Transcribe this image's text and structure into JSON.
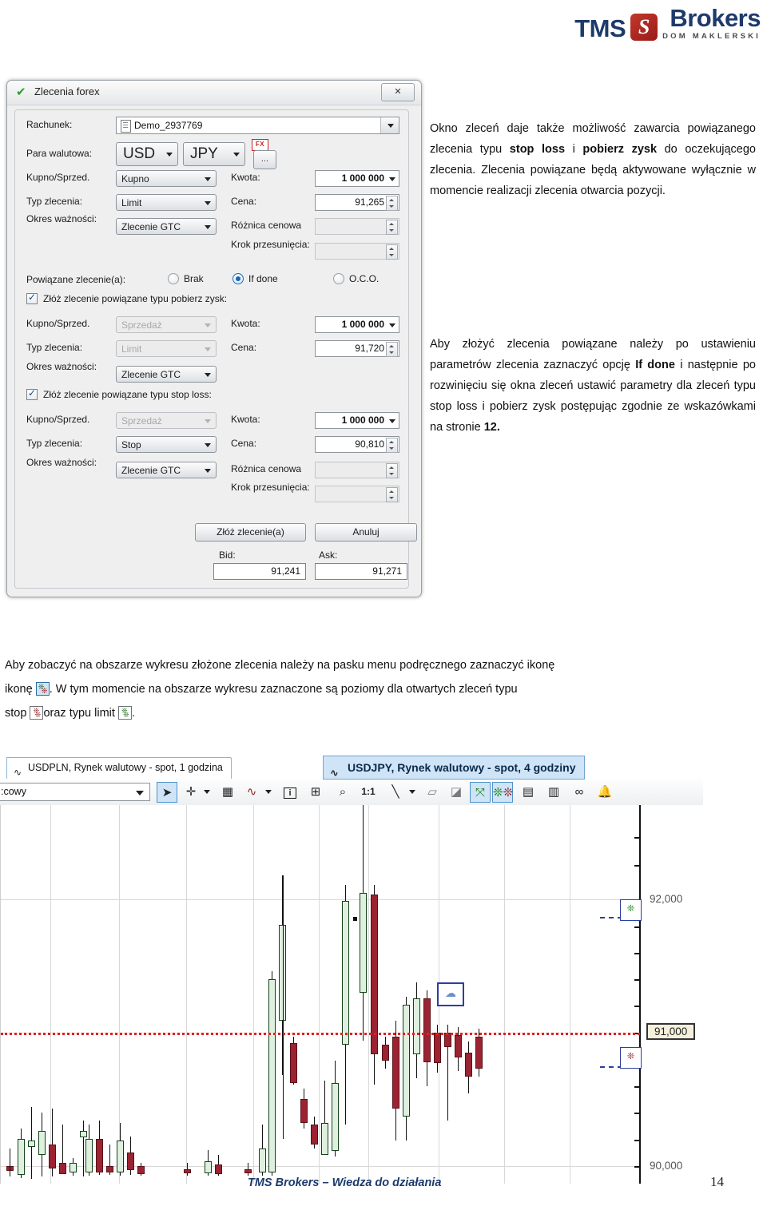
{
  "header": {
    "brand_left": "TMS",
    "brand_mark": "S",
    "brand_right": "Brokers",
    "brand_sub": "DOM MAKLERSKI",
    "brand_color": "#1d3a6b",
    "mark_color": "#9b1b1b"
  },
  "dialog": {
    "title": "Zlecenia forex",
    "close_label": "✕",
    "check_icon": "✔",
    "account": {
      "label": "Rachunek:",
      "value": "Demo_2937769"
    },
    "pair": {
      "label": "Para walutowa:",
      "base": "USD",
      "quote": "JPY",
      "fx_badge": "FX",
      "more_button": "..."
    },
    "main_order": {
      "side_label": "Kupno/Sprzed.",
      "side_value": "Kupno",
      "amount_label": "Kwota:",
      "amount_value": "1 000 000",
      "type_label": "Typ zlecenia:",
      "type_value": "Limit",
      "price_label": "Cena:",
      "price_value": "91,265",
      "validity_label": "Okres ważności:",
      "validity_value": "Zlecenie GTC",
      "spread_label": "Różnica cenowa",
      "spread_value": "",
      "step_label": "Krok przesunięcia:",
      "step_value": ""
    },
    "linked": {
      "label": "Powiązane zlecenie(a):",
      "option_none": "Brak",
      "option_ifdone": "If done",
      "option_oco": "O.C.O.",
      "selected": "If done"
    },
    "take_profit": {
      "checkbox_label": "Złóż zlecenie powiązane typu pobierz zysk:",
      "checked": true,
      "side_label": "Kupno/Sprzed.",
      "side_value": "Sprzedaż",
      "amount_label": "Kwota:",
      "amount_value": "1 000 000",
      "type_label": "Typ zlecenia:",
      "type_value": "Limit",
      "price_label": "Cena:",
      "price_value": "91,720",
      "validity_label": "Okres ważności:",
      "validity_value": "Zlecenie GTC"
    },
    "stop_loss": {
      "checkbox_label": "Złóż zlecenie powiązane typu stop loss:",
      "checked": true,
      "side_label": "Kupno/Sprzed.",
      "side_value": "Sprzedaż",
      "amount_label": "Kwota:",
      "amount_value": "1 000 000",
      "type_label": "Typ zlecenia:",
      "type_value": "Stop",
      "price_label": "Cena:",
      "price_value": "90,810",
      "validity_label": "Okres ważności:",
      "validity_value": "Zlecenie GTC",
      "spread_label": "Różnica cenowa",
      "spread_value": "",
      "step_label": "Krok przesunięcia:",
      "step_value": ""
    },
    "buttons": {
      "submit": "Złóż zlecenie(a)",
      "cancel": "Anuluj"
    },
    "quotes": {
      "bid_label": "Bid:",
      "bid_value": "91,241",
      "ask_label": "Ask:",
      "ask_value": "91,271"
    }
  },
  "text": {
    "para1_a": "Okno zleceń daje także możliwość zawarcia powiązanego zlecenia typu ",
    "para1_b1": "stop loss",
    "para1_mid": " i ",
    "para1_b2": "pobierz zysk",
    "para1_c": " do oczekującego zlecenia. Zlecenia powiązane będą aktywowane wyłącznie w momencie realizacji zlecenia otwarcia pozycji.",
    "para2_a": "Aby złożyć zlecenia powiązane należy po ustawieniu parametrów zlecenia zaznaczyć opcję ",
    "para2_b1": "If done",
    "para2_c": " i następnie po rozwinięciu się okna zleceń ustawić parametry dla zleceń typu stop loss i pobierz zysk postępując zgodnie ze wskazówkami na stronie ",
    "para2_b2": "12.",
    "para3_a": "Aby zobaczyć na obszarze wykresu złożone zlecenia należy na pasku menu podręcznego zaznaczyć ikonę",
    "para3_b": ". W tym momencie na obszarze wykresu zaznaczone są poziomy dla otwartych zleceń typu",
    "para3_c": "stop",
    "para3_d": "oraz typu limit",
    "para3_e": "."
  },
  "chart_panel": {
    "tabs": [
      {
        "label": "USDPLN, Rynek walutowy - spot, 1 godzina",
        "active": false,
        "icon": "wave-icon"
      },
      {
        "label": "USDJPY, Rynek walutowy - spot, 4 godziny",
        "active": true,
        "icon": "wave-icon"
      }
    ],
    "toolbar": {
      "period_value": ":cowy",
      "items": [
        {
          "name": "pointer-icon",
          "glyph": "➤",
          "selected": true
        },
        {
          "name": "crosshair-icon",
          "glyph": "✛",
          "selected": false
        },
        {
          "name": "crosshair-dropdown-icon",
          "glyph": "▾",
          "selected": false
        },
        {
          "name": "grid-icon",
          "glyph": "▦",
          "selected": false
        },
        {
          "name": "indicator-icon",
          "glyph": "∿",
          "selected": false
        },
        {
          "name": "indicator-dropdown-icon",
          "glyph": "▾",
          "selected": false
        },
        {
          "name": "info-icon",
          "glyph": "i",
          "selected": false
        },
        {
          "name": "add-window-icon",
          "glyph": "⊞",
          "selected": false
        },
        {
          "name": "zoom-icon",
          "glyph": "⌕",
          "selected": false
        },
        {
          "name": "one-to-one-icon",
          "glyph": "1:1",
          "selected": false
        },
        {
          "name": "trendline-icon",
          "glyph": "╲",
          "selected": false
        },
        {
          "name": "trendline-dropdown-icon",
          "glyph": "▾",
          "selected": false
        },
        {
          "name": "eraser-icon",
          "glyph": "▱",
          "selected": false
        },
        {
          "name": "erase-all-icon",
          "glyph": "◪",
          "selected": false
        },
        {
          "name": "positions-icon",
          "glyph": "⤧",
          "selected": true
        },
        {
          "name": "orders-icon",
          "glyph": "⁂",
          "selected": true
        },
        {
          "name": "new-chart-icon",
          "glyph": "▤",
          "selected": false
        },
        {
          "name": "chart-template-icon",
          "glyph": "▥",
          "selected": false
        },
        {
          "name": "link-icon",
          "glyph": "∞",
          "selected": false
        },
        {
          "name": "alert-bell-icon",
          "glyph": "🔔",
          "selected": false
        }
      ]
    },
    "price_axis_labels": [
      "92,000",
      "91,000",
      "90,000"
    ],
    "current_price_tag": "91,000"
  },
  "chart_data": {
    "type": "candlestick",
    "title": "USDJPY, Rynek walutowy - spot, 4 godziny",
    "ylabel": "",
    "ylim": [
      89.55,
      92.4
    ],
    "yticks": [
      92.0,
      91.0,
      90.0
    ],
    "ytick_labels": [
      "92,000",
      "91,000",
      "90,000"
    ],
    "grid": true,
    "legend": "none",
    "annotations": {
      "current_price_line": 91.0,
      "take_profit_level": 91.72,
      "stop_loss_level": 90.81,
      "tooltip": "91,000"
    },
    "candles": [
      {
        "x": 6,
        "o": 89.7,
        "h": 89.76,
        "l": 89.63,
        "c": 89.68,
        "dir": "down"
      },
      {
        "x": 20,
        "o": 89.68,
        "h": 89.95,
        "l": 89.62,
        "c": 89.88,
        "dir": "up"
      },
      {
        "x": 33,
        "o": 89.88,
        "h": 90.12,
        "l": 89.7,
        "c": 89.86,
        "dir": "down"
      },
      {
        "x": 46,
        "o": 89.86,
        "h": 90.1,
        "l": 89.72,
        "c": 90.02,
        "dir": "up"
      },
      {
        "x": 59,
        "o": 90.02,
        "h": 90.1,
        "l": 89.7,
        "c": 89.76,
        "dir": "down"
      },
      {
        "x": 72,
        "o": 89.76,
        "h": 89.97,
        "l": 89.63,
        "c": 89.68,
        "dir": "down"
      },
      {
        "x": 85,
        "o": 89.68,
        "h": 89.74,
        "l": 89.62,
        "c": 89.7,
        "dir": "up"
      },
      {
        "x": 105,
        "o": 89.78,
        "h": 90.0,
        "l": 89.64,
        "c": 89.95,
        "dir": "up"
      },
      {
        "x": 118,
        "o": 89.98,
        "h": 90.02,
        "l": 89.64,
        "c": 89.8,
        "dir": "down"
      },
      {
        "x": 131,
        "o": 89.8,
        "h": 89.86,
        "l": 89.64,
        "c": 89.78,
        "dir": "down"
      },
      {
        "x": 144,
        "o": 89.78,
        "h": 90.02,
        "l": 89.62,
        "c": 89.94,
        "dir": "up"
      },
      {
        "x": 157,
        "o": 89.94,
        "h": 89.96,
        "l": 89.7,
        "c": 89.8,
        "dir": "down"
      },
      {
        "x": 170,
        "o": 89.8,
        "h": 89.82,
        "l": 89.62,
        "c": 89.7,
        "dir": "down"
      },
      {
        "x": 228,
        "o": 89.66,
        "h": 89.7,
        "l": 89.62,
        "c": 89.65,
        "dir": "down"
      },
      {
        "x": 254,
        "o": 89.7,
        "h": 89.84,
        "l": 89.63,
        "c": 89.8,
        "dir": "up"
      },
      {
        "x": 267,
        "o": 89.8,
        "h": 89.84,
        "l": 89.62,
        "c": 89.7,
        "dir": "down"
      },
      {
        "x": 304,
        "o": 89.68,
        "h": 89.72,
        "l": 89.62,
        "c": 89.7,
        "dir": "down"
      },
      {
        "x": 322,
        "o": 89.78,
        "h": 90.0,
        "l": 89.66,
        "c": 89.94,
        "dir": "up"
      },
      {
        "x": 334,
        "o": 89.96,
        "h": 91.3,
        "l": 89.68,
        "c": 91.2,
        "dir": "up"
      },
      {
        "x": 347,
        "o": 91.22,
        "h": 92.1,
        "l": 90.9,
        "c": 91.92,
        "dir": "up"
      },
      {
        "x": 348,
        "o": 90.95,
        "h": 92.12,
        "l": 89.6,
        "c": 91.0,
        "dir": "up"
      },
      {
        "x": 361,
        "o": 91.0,
        "h": 91.12,
        "l": 90.72,
        "c": 90.78,
        "dir": "down"
      },
      {
        "x": 374,
        "o": 90.78,
        "h": 90.84,
        "l": 90.62,
        "c": 90.7,
        "dir": "down"
      },
      {
        "x": 387,
        "o": 90.66,
        "h": 90.7,
        "l": 90.52,
        "c": 90.58,
        "dir": "down"
      },
      {
        "x": 400,
        "o": 90.68,
        "h": 90.92,
        "l": 90.62,
        "c": 90.8,
        "dir": "up"
      },
      {
        "x": 413,
        "o": 90.8,
        "h": 91.28,
        "l": 90.7,
        "c": 91.18,
        "dir": "up"
      },
      {
        "x": 426,
        "o": 91.28,
        "h": 92.18,
        "l": 91.2,
        "c": 92.08,
        "dir": "up"
      },
      {
        "x": 448,
        "o": 92.1,
        "h": 92.4,
        "l": 91.38,
        "c": 91.5,
        "dir": "up"
      },
      {
        "x": 462,
        "o": 91.98,
        "h": 92.15,
        "l": 90.98,
        "c": 91.02,
        "dir": "down"
      },
      {
        "x": 476,
        "o": 90.96,
        "h": 91.0,
        "l": 90.78,
        "c": 90.86,
        "dir": "down"
      },
      {
        "x": 489,
        "o": 90.9,
        "h": 91.42,
        "l": 90.44,
        "c": 90.6,
        "dir": "down"
      },
      {
        "x": 502,
        "o": 90.62,
        "h": 91.52,
        "l": 90.38,
        "c": 91.4,
        "dir": "up"
      },
      {
        "x": 515,
        "o": 91.4,
        "h": 91.6,
        "l": 91.2,
        "c": 91.48,
        "dir": "up"
      },
      {
        "x": 528,
        "o": 91.46,
        "h": 91.52,
        "l": 91.18,
        "c": 91.24,
        "dir": "down"
      },
      {
        "x": 541,
        "o": 91.24,
        "h": 91.3,
        "l": 91.06,
        "c": 91.12,
        "dir": "down"
      },
      {
        "x": 554,
        "o": 91.12,
        "h": 91.36,
        "l": 90.64,
        "c": 91.08,
        "dir": "down"
      },
      {
        "x": 567,
        "o": 91.1,
        "h": 91.18,
        "l": 91.02,
        "c": 91.06,
        "dir": "up"
      },
      {
        "x": 580,
        "o": 91.1,
        "h": 91.22,
        "l": 90.72,
        "c": 90.92,
        "dir": "down"
      },
      {
        "x": 593,
        "o": 90.96,
        "h": 91.18,
        "l": 90.78,
        "c": 90.88,
        "dir": "down"
      }
    ]
  },
  "footer": {
    "text": "TMS Brokers – Wiedza do działania",
    "page": "14"
  }
}
